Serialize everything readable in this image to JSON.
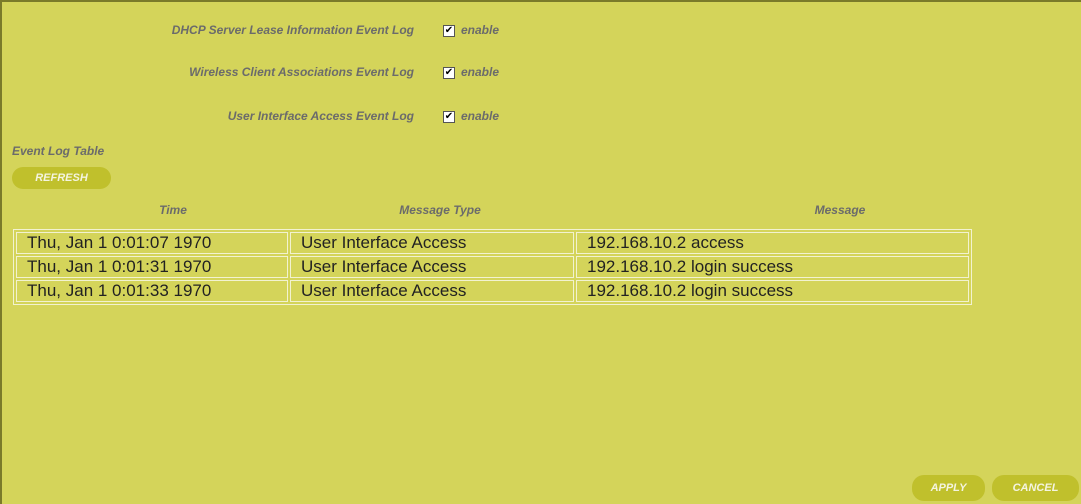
{
  "settings": {
    "rows": [
      {
        "label": "DHCP Server Lease Information Event Log",
        "checked": true,
        "enable_label": "enable"
      },
      {
        "label": "Wireless Client Associations Event Log",
        "checked": true,
        "enable_label": "enable"
      },
      {
        "label": "User Interface Access Event Log",
        "checked": true,
        "enable_label": "enable"
      }
    ]
  },
  "event_log": {
    "title": "Event Log Table",
    "refresh_label": "REFRESH",
    "columns": [
      "Time",
      "Message Type",
      "Message"
    ],
    "rows": [
      [
        "Thu, Jan 1 0:01:07 1970",
        "User Interface Access",
        "192.168.10.2 access"
      ],
      [
        "Thu, Jan 1 0:01:31 1970",
        "User Interface Access",
        "192.168.10.2 login success"
      ],
      [
        "Thu, Jan 1 0:01:33 1970",
        "User Interface Access",
        "192.168.10.2 login success"
      ]
    ]
  },
  "actions": {
    "apply_label": "APPLY",
    "cancel_label": "CANCEL"
  },
  "colors": {
    "background": "#d4d45a",
    "button": "#c0c02c",
    "label_text": "#6b6b6b",
    "cell_border": "#f2f2d0"
  }
}
